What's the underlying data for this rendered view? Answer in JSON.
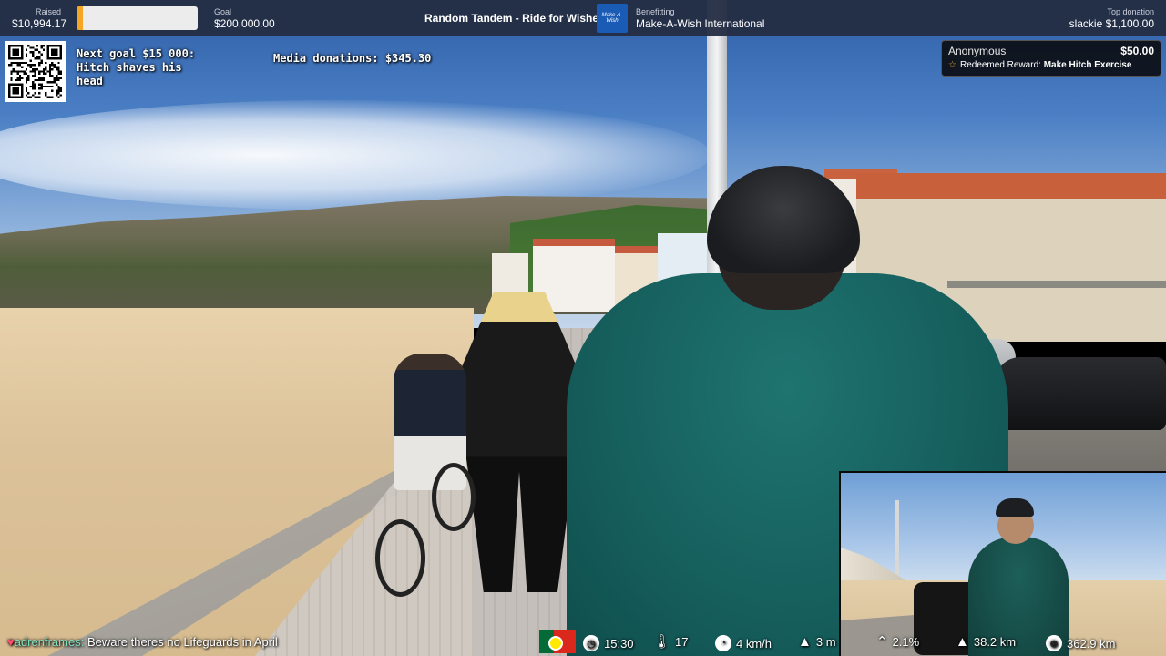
{
  "stream": {
    "title": "Random Tandem - Ride for Wishes"
  },
  "topbar": {
    "raised_label": "Raised",
    "raised_value": "$10,994.17",
    "progress_fraction": 0.055,
    "goal_label": "Goal",
    "goal_value": "$200,000.00",
    "benefitting_label": "Benefitting",
    "benefitting_value": "Make-A-Wish International",
    "logo_text": "Make-A-Wish",
    "top_donation_label": "Top donation",
    "top_donation_value": "slackie $1,100.00"
  },
  "overlay": {
    "next_goal": "Next goal $15 000:\nHitch shaves his\nhead",
    "media_donations": "Media donations: $345.30"
  },
  "alert": {
    "donor": "Anonymous",
    "amount": "$50.00",
    "reward_prefix": "Redeemed Reward:",
    "reward_name": "Make Hitch Exercise"
  },
  "chat": {
    "username": "adrenframes:",
    "message": "Beware theres no Lifeguards in April"
  },
  "stats": {
    "time": "15:30",
    "temperature": "17",
    "speed": "4 km/h",
    "altitude": "3 m",
    "grade": "2.1%",
    "distance_today": "38.2 km",
    "distance_total": "362.9 km"
  },
  "colors": {
    "topbar_bg": "#242c42",
    "progress_fill": "#f5a623",
    "chat_user": "#7ee0c2",
    "heart": "#ff4d6d"
  },
  "icons": {
    "heart": "heart-icon",
    "clock": "clock-icon",
    "thermometer": "thermometer-icon",
    "speedometer": "speedometer-icon",
    "altitude": "mountain-icon",
    "grade": "chevron-up-icon",
    "distance": "road-icon",
    "globe": "globe-icon",
    "star": "star-icon",
    "flag": "portugal-flag-icon"
  }
}
